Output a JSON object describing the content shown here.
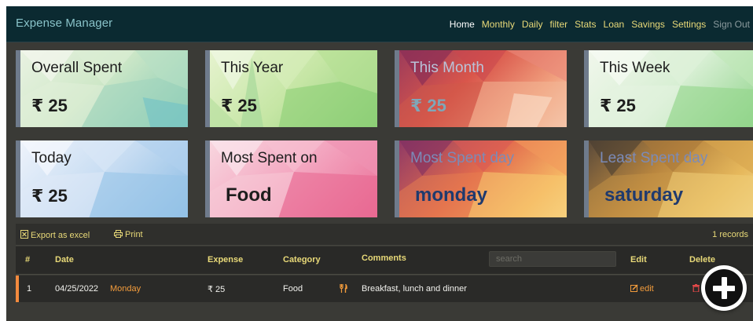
{
  "app": {
    "title": "Expense Manager"
  },
  "nav": {
    "items": [
      "Home",
      "Monthly",
      "Daily",
      "filter",
      "Stats",
      "Loan",
      "Savings",
      "Settings",
      "Sign Out"
    ],
    "active": "Home"
  },
  "cards": [
    {
      "title": "Overall Spent",
      "value": "₹ 25"
    },
    {
      "title": "This Year",
      "value": "₹ 25"
    },
    {
      "title": "This Month",
      "value": "₹ 25"
    },
    {
      "title": "This Week",
      "value": "₹ 25"
    },
    {
      "title": "Today",
      "value": "₹ 25"
    },
    {
      "title": "Most Spent on",
      "value": "Food"
    },
    {
      "title": "Most Spent day",
      "value": "monday"
    },
    {
      "title": "Least Spent day",
      "value": "saturday"
    }
  ],
  "toolbar": {
    "export_label": "Export as excel",
    "print_label": "Print",
    "records": "1 records"
  },
  "table": {
    "headers": [
      "#",
      "Date",
      "Expense",
      "Category",
      "Comments",
      "Edit",
      "Delete"
    ],
    "search_placeholder": "search",
    "rows": [
      {
        "num": "1",
        "date": "04/25/2022",
        "day": "Monday",
        "expense": "₹ 25",
        "category": "Food",
        "comments": "Breakfast, lunch and dinner",
        "edit": "edit"
      }
    ]
  },
  "colors": {
    "navbar": "#0b2a31",
    "accent": "#e8d978",
    "orange": "#f39c3c",
    "danger": "#e04848"
  },
  "icons": [
    "excel-icon",
    "print-icon",
    "fork-knife-icon",
    "pencil-icon",
    "trash-icon",
    "plus-icon"
  ]
}
